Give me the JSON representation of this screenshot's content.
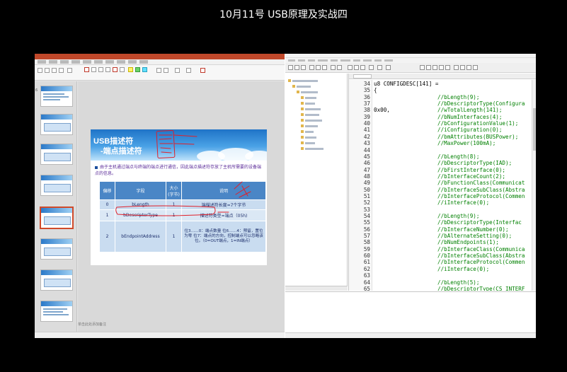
{
  "video_title": "10月11号 USB原理及实战四",
  "powerpoint": {
    "slide": {
      "title_line1": "USB描述符",
      "title_line2": "-端点描述符",
      "bullet": "由于主机通过端点与终端的端点进行通信，因此端点描述符存放了主机所需要的设备端点的信息。",
      "table": {
        "headers": [
          "偏移",
          "字段",
          "大小(字节)",
          "说明"
        ],
        "rows": [
          [
            "0",
            "bLength",
            "1",
            "端描述符长度=7个字节"
          ],
          [
            "1",
            "bDescriptorType",
            "1",
            "描述符类型=端点（05h)"
          ],
          [
            "2",
            "bEndpointAddress",
            "1",
            "位3……0：端点数量 位6……4：预留，置位为零 位7：端点的方向，控制端点可以忽略该位。（0=OUT端点，1=IN端点）"
          ]
        ]
      }
    },
    "notes_placeholder": "单击此处添加备注"
  },
  "ide": {
    "lines": [
      {
        "n": "34",
        "code": "u8 CONFIGDESC[141] =",
        "comment": ""
      },
      {
        "n": "35",
        "code": "{",
        "comment": ""
      },
      {
        "n": "36",
        "code": "",
        "comment": "//bLength(9);"
      },
      {
        "n": "37",
        "code": "",
        "comment": "//bDescriptorType(Configura"
      },
      {
        "n": "38",
        "code": "0x00,",
        "comment": "//wTotalLength(141);"
      },
      {
        "n": "39",
        "code": "",
        "comment": "//bNumInterfaces(4);"
      },
      {
        "n": "40",
        "code": "",
        "comment": "//bConfigurationValue(1);"
      },
      {
        "n": "41",
        "code": "",
        "comment": "//iConfiguration(0);"
      },
      {
        "n": "42",
        "code": "",
        "comment": "//bmAttributes(BUSPower);"
      },
      {
        "n": "43",
        "code": "",
        "comment": "//MaxPower(100mA);"
      },
      {
        "n": "44",
        "code": "",
        "comment": ""
      },
      {
        "n": "45",
        "code": "",
        "comment": "//bLength(8);"
      },
      {
        "n": "46",
        "code": "",
        "comment": "//bDescriptorType(IAD);"
      },
      {
        "n": "47",
        "code": "",
        "comment": "//bFirstInterface(0);"
      },
      {
        "n": "48",
        "code": "",
        "comment": "//bInterfaceCount(2);"
      },
      {
        "n": "49",
        "code": "",
        "comment": "//bFunctionClass(Communicat"
      },
      {
        "n": "50",
        "code": "",
        "comment": "//bInterfaceSubClass(Abstra"
      },
      {
        "n": "51",
        "code": "",
        "comment": "//bInterfaceProtocol(Commen"
      },
      {
        "n": "52",
        "code": "",
        "comment": "//iInterface(0);"
      },
      {
        "n": "53",
        "code": "",
        "comment": ""
      },
      {
        "n": "54",
        "code": "",
        "comment": "//bLength(9);"
      },
      {
        "n": "55",
        "code": "",
        "comment": "//bDescriptorType(Interfac"
      },
      {
        "n": "56",
        "code": "",
        "comment": "//bInterfaceNumber(0);"
      },
      {
        "n": "57",
        "code": "",
        "comment": "//bAlternateSetting(0);"
      },
      {
        "n": "58",
        "code": "",
        "comment": "//bNumEndpoints(1);"
      },
      {
        "n": "59",
        "code": "",
        "comment": "//bInterfaceClass(Communica"
      },
      {
        "n": "60",
        "code": "",
        "comment": "//bInterfaceSubClass(Abstra"
      },
      {
        "n": "61",
        "code": "",
        "comment": "//bInterfaceProtocol(Commen"
      },
      {
        "n": "62",
        "code": "",
        "comment": "//iInterface(0);"
      },
      {
        "n": "63",
        "code": "",
        "comment": ""
      },
      {
        "n": "64",
        "code": "",
        "comment": "//bLength(5);"
      },
      {
        "n": "65",
        "code": "",
        "comment": "//bDescriptorType(CS_INTERF"
      }
    ]
  }
}
